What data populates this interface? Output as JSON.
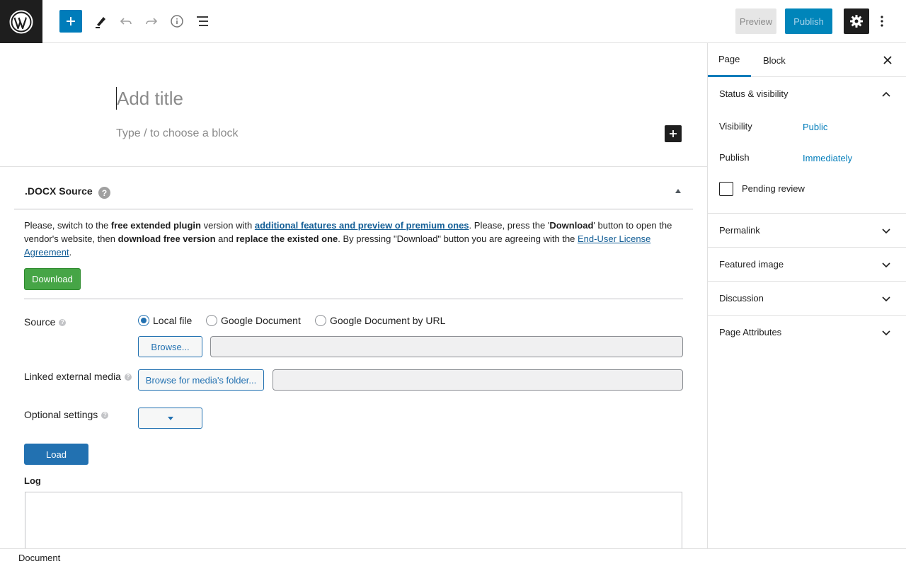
{
  "header": {
    "preview_label": "Preview",
    "publish_label": "Publish"
  },
  "editor": {
    "title_placeholder": "Add title",
    "block_placeholder": "Type / to choose a block"
  },
  "metabox": {
    "title": ".DOCX Source",
    "help_glyph": "?",
    "notice": {
      "p1": "Please, switch to the ",
      "b1": "free extended plugin",
      "p2": " version with ",
      "link1": "additional features and preview of premium ones",
      "p3": ". Please, press the '",
      "b2": "Download",
      "p4": "' button to open the vendor's website, then ",
      "b3": "download free version",
      "p5": " and ",
      "b4": "replace the existed one",
      "p6": ". By pressing \"Download\" button you are agreeing with the ",
      "link2": "End-User License Agreement",
      "p7": "."
    },
    "download_label": "Download",
    "source_label": "Source",
    "source_options": [
      "Local file",
      "Google Document",
      "Google Document by URL"
    ],
    "source_selected": "Local file",
    "browse_label": "Browse...",
    "linked_media_label": "Linked external media",
    "browse_media_label": "Browse for media's folder...",
    "optional_settings_label": "Optional settings",
    "load_label": "Load",
    "log_label": "Log"
  },
  "footer": {
    "breadcrumb": "Document"
  },
  "sidebar": {
    "tabs": [
      "Page",
      "Block"
    ],
    "active_tab": "Page",
    "status_visibility": {
      "title": "Status & visibility",
      "visibility_label": "Visibility",
      "visibility_value": "Public",
      "publish_label": "Publish",
      "publish_value": "Immediately",
      "pending_review_label": "Pending review"
    },
    "panels": [
      "Permalink",
      "Featured image",
      "Discussion",
      "Page Attributes"
    ]
  },
  "colors": {
    "accent": "#007cba",
    "download_green": "#46a546",
    "wp_button": "#2271b1"
  }
}
